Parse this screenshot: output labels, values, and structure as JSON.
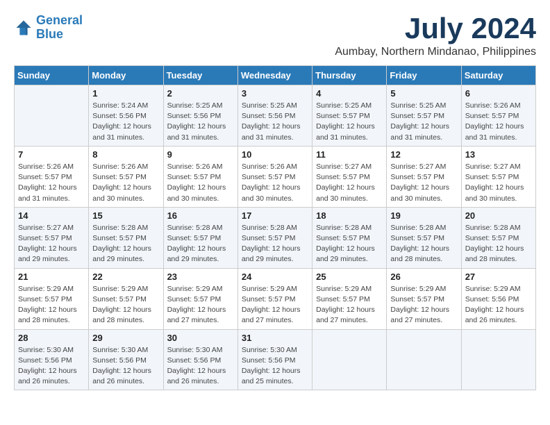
{
  "logo": {
    "line1": "General",
    "line2": "Blue"
  },
  "title": "July 2024",
  "location": "Aumbay, Northern Mindanao, Philippines",
  "days_header": [
    "Sunday",
    "Monday",
    "Tuesday",
    "Wednesday",
    "Thursday",
    "Friday",
    "Saturday"
  ],
  "weeks": [
    [
      {
        "day": "",
        "sunrise": "",
        "sunset": "",
        "daylight": ""
      },
      {
        "day": "1",
        "sunrise": "Sunrise: 5:24 AM",
        "sunset": "Sunset: 5:56 PM",
        "daylight": "Daylight: 12 hours and 31 minutes."
      },
      {
        "day": "2",
        "sunrise": "Sunrise: 5:25 AM",
        "sunset": "Sunset: 5:56 PM",
        "daylight": "Daylight: 12 hours and 31 minutes."
      },
      {
        "day": "3",
        "sunrise": "Sunrise: 5:25 AM",
        "sunset": "Sunset: 5:56 PM",
        "daylight": "Daylight: 12 hours and 31 minutes."
      },
      {
        "day": "4",
        "sunrise": "Sunrise: 5:25 AM",
        "sunset": "Sunset: 5:57 PM",
        "daylight": "Daylight: 12 hours and 31 minutes."
      },
      {
        "day": "5",
        "sunrise": "Sunrise: 5:25 AM",
        "sunset": "Sunset: 5:57 PM",
        "daylight": "Daylight: 12 hours and 31 minutes."
      },
      {
        "day": "6",
        "sunrise": "Sunrise: 5:26 AM",
        "sunset": "Sunset: 5:57 PM",
        "daylight": "Daylight: 12 hours and 31 minutes."
      }
    ],
    [
      {
        "day": "7",
        "sunrise": "Sunrise: 5:26 AM",
        "sunset": "Sunset: 5:57 PM",
        "daylight": "Daylight: 12 hours and 31 minutes."
      },
      {
        "day": "8",
        "sunrise": "Sunrise: 5:26 AM",
        "sunset": "Sunset: 5:57 PM",
        "daylight": "Daylight: 12 hours and 30 minutes."
      },
      {
        "day": "9",
        "sunrise": "Sunrise: 5:26 AM",
        "sunset": "Sunset: 5:57 PM",
        "daylight": "Daylight: 12 hours and 30 minutes."
      },
      {
        "day": "10",
        "sunrise": "Sunrise: 5:26 AM",
        "sunset": "Sunset: 5:57 PM",
        "daylight": "Daylight: 12 hours and 30 minutes."
      },
      {
        "day": "11",
        "sunrise": "Sunrise: 5:27 AM",
        "sunset": "Sunset: 5:57 PM",
        "daylight": "Daylight: 12 hours and 30 minutes."
      },
      {
        "day": "12",
        "sunrise": "Sunrise: 5:27 AM",
        "sunset": "Sunset: 5:57 PM",
        "daylight": "Daylight: 12 hours and 30 minutes."
      },
      {
        "day": "13",
        "sunrise": "Sunrise: 5:27 AM",
        "sunset": "Sunset: 5:57 PM",
        "daylight": "Daylight: 12 hours and 30 minutes."
      }
    ],
    [
      {
        "day": "14",
        "sunrise": "Sunrise: 5:27 AM",
        "sunset": "Sunset: 5:57 PM",
        "daylight": "Daylight: 12 hours and 29 minutes."
      },
      {
        "day": "15",
        "sunrise": "Sunrise: 5:28 AM",
        "sunset": "Sunset: 5:57 PM",
        "daylight": "Daylight: 12 hours and 29 minutes."
      },
      {
        "day": "16",
        "sunrise": "Sunrise: 5:28 AM",
        "sunset": "Sunset: 5:57 PM",
        "daylight": "Daylight: 12 hours and 29 minutes."
      },
      {
        "day": "17",
        "sunrise": "Sunrise: 5:28 AM",
        "sunset": "Sunset: 5:57 PM",
        "daylight": "Daylight: 12 hours and 29 minutes."
      },
      {
        "day": "18",
        "sunrise": "Sunrise: 5:28 AM",
        "sunset": "Sunset: 5:57 PM",
        "daylight": "Daylight: 12 hours and 29 minutes."
      },
      {
        "day": "19",
        "sunrise": "Sunrise: 5:28 AM",
        "sunset": "Sunset: 5:57 PM",
        "daylight": "Daylight: 12 hours and 28 minutes."
      },
      {
        "day": "20",
        "sunrise": "Sunrise: 5:28 AM",
        "sunset": "Sunset: 5:57 PM",
        "daylight": "Daylight: 12 hours and 28 minutes."
      }
    ],
    [
      {
        "day": "21",
        "sunrise": "Sunrise: 5:29 AM",
        "sunset": "Sunset: 5:57 PM",
        "daylight": "Daylight: 12 hours and 28 minutes."
      },
      {
        "day": "22",
        "sunrise": "Sunrise: 5:29 AM",
        "sunset": "Sunset: 5:57 PM",
        "daylight": "Daylight: 12 hours and 28 minutes."
      },
      {
        "day": "23",
        "sunrise": "Sunrise: 5:29 AM",
        "sunset": "Sunset: 5:57 PM",
        "daylight": "Daylight: 12 hours and 27 minutes."
      },
      {
        "day": "24",
        "sunrise": "Sunrise: 5:29 AM",
        "sunset": "Sunset: 5:57 PM",
        "daylight": "Daylight: 12 hours and 27 minutes."
      },
      {
        "day": "25",
        "sunrise": "Sunrise: 5:29 AM",
        "sunset": "Sunset: 5:57 PM",
        "daylight": "Daylight: 12 hours and 27 minutes."
      },
      {
        "day": "26",
        "sunrise": "Sunrise: 5:29 AM",
        "sunset": "Sunset: 5:57 PM",
        "daylight": "Daylight: 12 hours and 27 minutes."
      },
      {
        "day": "27",
        "sunrise": "Sunrise: 5:29 AM",
        "sunset": "Sunset: 5:56 PM",
        "daylight": "Daylight: 12 hours and 26 minutes."
      }
    ],
    [
      {
        "day": "28",
        "sunrise": "Sunrise: 5:30 AM",
        "sunset": "Sunset: 5:56 PM",
        "daylight": "Daylight: 12 hours and 26 minutes."
      },
      {
        "day": "29",
        "sunrise": "Sunrise: 5:30 AM",
        "sunset": "Sunset: 5:56 PM",
        "daylight": "Daylight: 12 hours and 26 minutes."
      },
      {
        "day": "30",
        "sunrise": "Sunrise: 5:30 AM",
        "sunset": "Sunset: 5:56 PM",
        "daylight": "Daylight: 12 hours and 26 minutes."
      },
      {
        "day": "31",
        "sunrise": "Sunrise: 5:30 AM",
        "sunset": "Sunset: 5:56 PM",
        "daylight": "Daylight: 12 hours and 25 minutes."
      },
      {
        "day": "",
        "sunrise": "",
        "sunset": "",
        "daylight": ""
      },
      {
        "day": "",
        "sunrise": "",
        "sunset": "",
        "daylight": ""
      },
      {
        "day": "",
        "sunrise": "",
        "sunset": "",
        "daylight": ""
      }
    ]
  ]
}
